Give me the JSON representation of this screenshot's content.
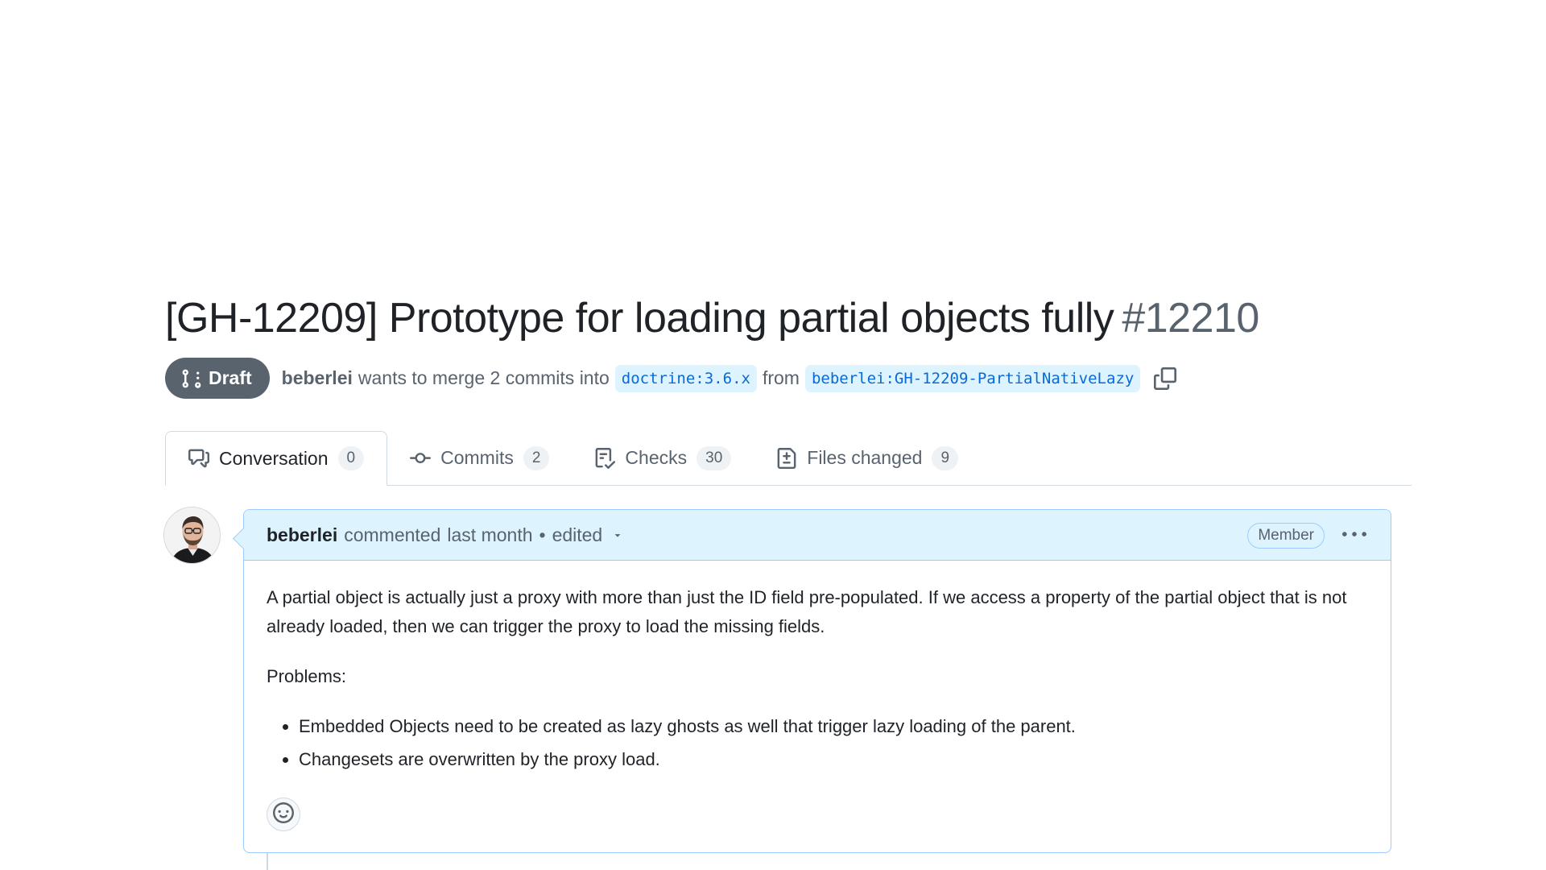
{
  "pr": {
    "title": "[GH-12209] Prototype for loading partial objects fully",
    "number": "#12210",
    "status": "Draft",
    "author": "beberlei",
    "merge_text": "wants to merge 2 commits into",
    "base_branch": "doctrine:3.6.x",
    "from_text": "from",
    "head_branch": "beberlei:GH-12209-PartialNativeLazy"
  },
  "tabs": [
    {
      "label": "Conversation",
      "count": "0",
      "icon": "comment-discussion-icon"
    },
    {
      "label": "Commits",
      "count": "2",
      "icon": "git-commit-icon"
    },
    {
      "label": "Checks",
      "count": "30",
      "icon": "checklist-icon"
    },
    {
      "label": "Files changed",
      "count": "9",
      "icon": "file-diff-icon"
    }
  ],
  "comment": {
    "author": "beberlei",
    "action": "commented",
    "time": "last month",
    "separator": "•",
    "edited": "edited",
    "badge": "Member",
    "paragraphs": [
      "A partial object is actually just a proxy with more than just the ID field pre-populated. If we access a property of the partial object that is not already loaded, then we can trigger the proxy to load the missing fields.",
      "Problems:"
    ],
    "list": [
      "Embedded Objects need to be created as lazy ghosts as well that trigger lazy loading of the parent.",
      "Changesets are overwritten by the proxy load."
    ]
  },
  "colors": {
    "accent": "#0969da",
    "header_bg": "#ddf4ff",
    "draft_bg": "#59636e"
  }
}
